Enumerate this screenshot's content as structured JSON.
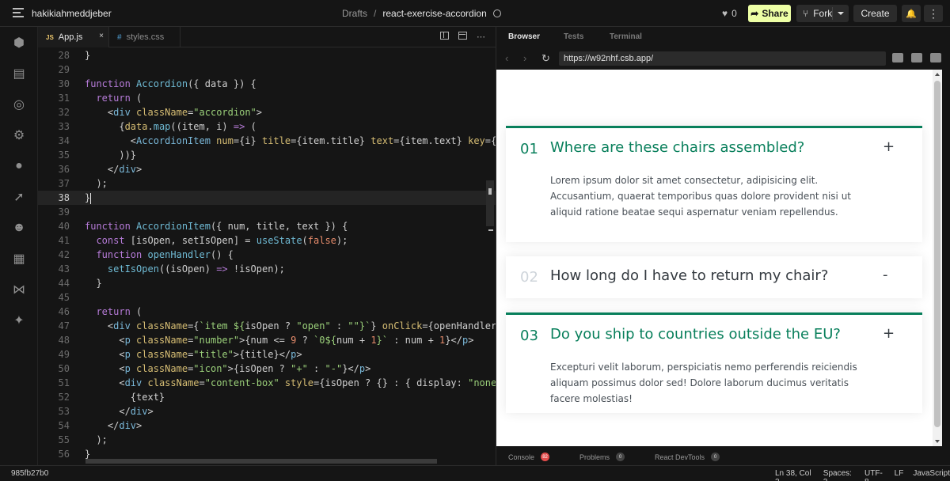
{
  "topbar": {
    "user": "hakikiahmeddjeber",
    "breadcrumb": {
      "folder": "Drafts",
      "separator": "/",
      "project": "react-exercise-accordion"
    },
    "likes": "0",
    "share_label": "Share",
    "fork_label": "Fork",
    "create_label": "Create",
    "more_label": "⋮"
  },
  "activity_bar": [
    "box-icon",
    "files-icon",
    "search-icon",
    "gear-icon",
    "github-icon",
    "rocket-icon",
    "users-icon",
    "docker-icon",
    "vscode-icon",
    "sparkle-icon"
  ],
  "editor": {
    "tabs": [
      {
        "badge": "JS",
        "label": "App.js",
        "close": "×"
      },
      {
        "badge": "#",
        "label": "styles.css"
      }
    ],
    "lines": [
      {
        "n": "28",
        "t": [
          [
            "p",
            "}"
          ]
        ]
      },
      {
        "n": "29",
        "t": []
      },
      {
        "n": "30",
        "t": [
          [
            "k",
            "function "
          ],
          [
            "f",
            "Accordion"
          ],
          [
            "p",
            "({ data }) {"
          ]
        ]
      },
      {
        "n": "31",
        "t": [
          [
            "p",
            "  "
          ],
          [
            "k",
            "return"
          ],
          [
            "p",
            " ("
          ]
        ]
      },
      {
        "n": "32",
        "t": [
          [
            "p",
            "    <"
          ],
          [
            "t",
            "div"
          ],
          [
            "a",
            " className"
          ],
          [
            "p",
            "="
          ],
          [
            "s",
            "\"accordion\""
          ],
          [
            "p",
            ">"
          ]
        ]
      },
      {
        "n": "33",
        "t": [
          [
            "p",
            "      {"
          ],
          [
            "a",
            "data"
          ],
          [
            "p",
            "."
          ],
          [
            "f",
            "map"
          ],
          [
            "p",
            "((item, i) "
          ],
          [
            "k",
            "=>"
          ],
          [
            "p",
            " ("
          ]
        ]
      },
      {
        "n": "34",
        "t": [
          [
            "p",
            "        <"
          ],
          [
            "t",
            "AccordionItem"
          ],
          [
            "a",
            " num"
          ],
          [
            "p",
            "={i} "
          ],
          [
            "a",
            "title"
          ],
          [
            "p",
            "={item.title} "
          ],
          [
            "a",
            "text"
          ],
          [
            "p",
            "={item.text} "
          ],
          [
            "a",
            "key"
          ],
          [
            "p",
            "={"
          ]
        ]
      },
      {
        "n": "35",
        "t": [
          [
            "p",
            "      ))}"
          ]
        ]
      },
      {
        "n": "36",
        "t": [
          [
            "p",
            "    </"
          ],
          [
            "t",
            "div"
          ],
          [
            "p",
            ">"
          ]
        ]
      },
      {
        "n": "37",
        "t": [
          [
            "p",
            "  );"
          ]
        ]
      },
      {
        "n": "38",
        "t": [
          [
            "p",
            "}"
          ]
        ],
        "current": true
      },
      {
        "n": "39",
        "t": []
      },
      {
        "n": "40",
        "t": [
          [
            "k",
            "function "
          ],
          [
            "f",
            "AccordionItem"
          ],
          [
            "p",
            "({ num, title, text }) {"
          ]
        ]
      },
      {
        "n": "41",
        "t": [
          [
            "p",
            "  "
          ],
          [
            "k",
            "const"
          ],
          [
            "p",
            " [isOpen, setIsOpen] = "
          ],
          [
            "f",
            "useState"
          ],
          [
            "p",
            "("
          ],
          [
            "n",
            "false"
          ],
          [
            "p",
            ");"
          ]
        ]
      },
      {
        "n": "42",
        "t": [
          [
            "p",
            "  "
          ],
          [
            "k",
            "function "
          ],
          [
            "f",
            "openHandler"
          ],
          [
            "p",
            "() {"
          ]
        ]
      },
      {
        "n": "43",
        "t": [
          [
            "p",
            "    "
          ],
          [
            "f",
            "setIsOpen"
          ],
          [
            "p",
            "((isOpen) "
          ],
          [
            "k",
            "=>"
          ],
          [
            "p",
            " !isOpen);"
          ]
        ]
      },
      {
        "n": "44",
        "t": [
          [
            "p",
            "  }"
          ]
        ]
      },
      {
        "n": "45",
        "t": []
      },
      {
        "n": "46",
        "t": [
          [
            "p",
            "  "
          ],
          [
            "k",
            "return"
          ],
          [
            "p",
            " ("
          ]
        ]
      },
      {
        "n": "47",
        "t": [
          [
            "p",
            "    <"
          ],
          [
            "t",
            "div"
          ],
          [
            "a",
            " className"
          ],
          [
            "p",
            "={"
          ],
          [
            "s",
            "`item ${"
          ],
          [
            "p",
            "isOpen ? "
          ],
          [
            "s",
            "\"open\""
          ],
          [
            "p",
            " : "
          ],
          [
            "s",
            "\"\""
          ],
          [
            "s",
            "}`"
          ],
          [
            "p",
            "} "
          ],
          [
            "a",
            "onClick"
          ],
          [
            "p",
            "={openHandler"
          ]
        ]
      },
      {
        "n": "48",
        "t": [
          [
            "p",
            "      <"
          ],
          [
            "t",
            "p"
          ],
          [
            "a",
            " className"
          ],
          [
            "p",
            "="
          ],
          [
            "s",
            "\"number\""
          ],
          [
            "p",
            ">{num <= "
          ],
          [
            "n",
            "9"
          ],
          [
            "p",
            " ? "
          ],
          [
            "s",
            "`0${"
          ],
          [
            "p",
            "num + "
          ],
          [
            "n",
            "1"
          ],
          [
            "s",
            "}`"
          ],
          [
            "p",
            " : num + "
          ],
          [
            "n",
            "1"
          ],
          [
            "p",
            "}</"
          ],
          [
            "t",
            "p"
          ],
          [
            "p",
            ">"
          ]
        ]
      },
      {
        "n": "49",
        "t": [
          [
            "p",
            "      <"
          ],
          [
            "t",
            "p"
          ],
          [
            "a",
            " className"
          ],
          [
            "p",
            "="
          ],
          [
            "s",
            "\"title\""
          ],
          [
            "p",
            ">{title}</"
          ],
          [
            "t",
            "p"
          ],
          [
            "p",
            ">"
          ]
        ]
      },
      {
        "n": "50",
        "t": [
          [
            "p",
            "      <"
          ],
          [
            "t",
            "p"
          ],
          [
            "a",
            " className"
          ],
          [
            "p",
            "="
          ],
          [
            "s",
            "\"icon\""
          ],
          [
            "p",
            ">{isOpen ? "
          ],
          [
            "s",
            "\"+\""
          ],
          [
            "p",
            " : "
          ],
          [
            "s",
            "\"-\""
          ],
          [
            "p",
            "}</"
          ],
          [
            "t",
            "p"
          ],
          [
            "p",
            ">"
          ]
        ]
      },
      {
        "n": "51",
        "t": [
          [
            "p",
            "      <"
          ],
          [
            "t",
            "div"
          ],
          [
            "a",
            " className"
          ],
          [
            "p",
            "="
          ],
          [
            "s",
            "\"content-box\""
          ],
          [
            "a",
            " style"
          ],
          [
            "p",
            "={isOpen ? {} : { display: "
          ],
          [
            "s",
            "\"none"
          ]
        ]
      },
      {
        "n": "52",
        "t": [
          [
            "p",
            "        {text}"
          ]
        ]
      },
      {
        "n": "53",
        "t": [
          [
            "p",
            "      </"
          ],
          [
            "t",
            "div"
          ],
          [
            "p",
            ">"
          ]
        ]
      },
      {
        "n": "54",
        "t": [
          [
            "p",
            "    </"
          ],
          [
            "t",
            "div"
          ],
          [
            "p",
            ">"
          ]
        ]
      },
      {
        "n": "55",
        "t": [
          [
            "p",
            "  );"
          ]
        ]
      },
      {
        "n": "56",
        "t": [
          [
            "p",
            "}"
          ]
        ]
      }
    ]
  },
  "preview": {
    "tabs": [
      "Browser",
      "Tests",
      "Terminal"
    ],
    "url": "https://w92nhf.csb.app/",
    "accordion": [
      {
        "num": "01",
        "title": "Where are these chairs assembled?",
        "icon": "+",
        "open": true,
        "text": "Lorem ipsum dolor sit amet consectetur, adipisicing elit. Accusantium, quaerat temporibus quas dolore provident nisi ut aliquid ratione beatae sequi aspernatur veniam repellendus."
      },
      {
        "num": "02",
        "title": "How long do I have to return my chair?",
        "icon": "-",
        "open": false,
        "text": ""
      },
      {
        "num": "03",
        "title": "Do you ship to countries outside the EU?",
        "icon": "+",
        "open": true,
        "text": "Excepturi velit laborum, perspiciatis nemo perferendis reiciendis aliquam possimus dolor sed! Dolore laborum ducimus veritatis facere molestias!"
      }
    ],
    "bottom_tabs": [
      {
        "label": "Console",
        "count": "82"
      },
      {
        "label": "Problems",
        "count": "0"
      },
      {
        "label": "React DevTools",
        "count": "0"
      }
    ]
  },
  "statusbar": {
    "hash": "985fb27b0",
    "position": "Ln 38, Col 2",
    "spaces": "Spaces: 2",
    "encoding": "UTF-8",
    "eol": "LF",
    "language": "JavaScript"
  },
  "colors": {
    "accent": "#087f5b",
    "share": "#edffa5",
    "background": "#151515"
  }
}
